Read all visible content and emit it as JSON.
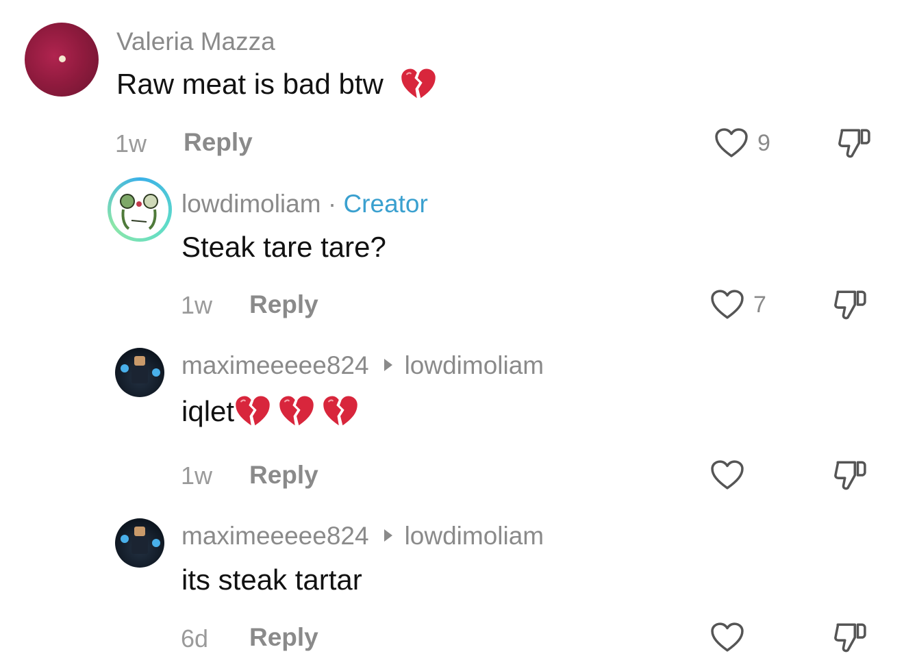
{
  "comments": [
    {
      "username": "Valeria Mazza",
      "text": "Raw meat is bad btw",
      "emojis": [
        "broken-heart"
      ],
      "time": "1w",
      "reply_label": "Reply",
      "likes": "9"
    },
    {
      "username": "lowdimoliam",
      "separator": "·",
      "badge": "Creator",
      "text": "Steak tare tare?",
      "time": "1w",
      "reply_label": "Reply",
      "likes": "7"
    },
    {
      "username": "maximeeeee824",
      "reply_to": "lowdimoliam",
      "text": "iqlet",
      "emojis": [
        "broken-heart",
        "broken-heart",
        "broken-heart"
      ],
      "time": "1w",
      "reply_label": "Reply",
      "likes": ""
    },
    {
      "username": "maximeeeee824",
      "reply_to": "lowdimoliam",
      "text": "its steak tartar",
      "time": "6d",
      "reply_label": "Reply",
      "likes": ""
    }
  ],
  "colors": {
    "meta_gray": "#8a8a8a",
    "creator_blue": "#3aa0cf",
    "broken_heart_red": "#d8263c"
  }
}
